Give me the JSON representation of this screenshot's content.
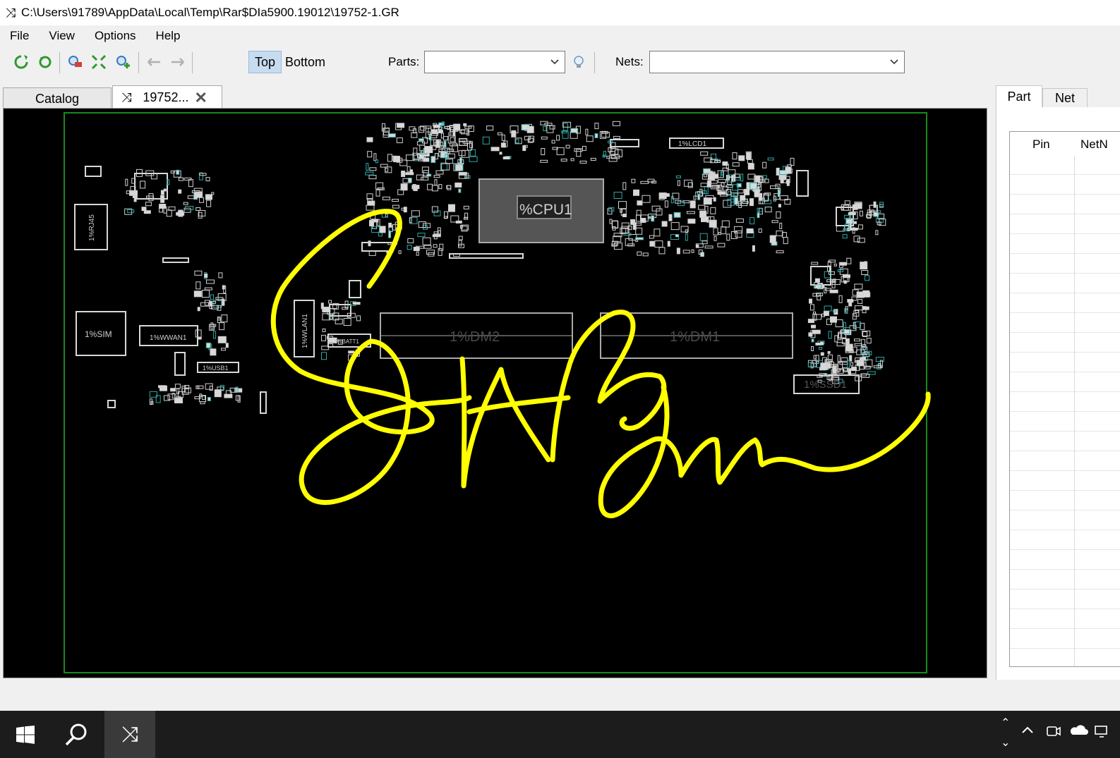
{
  "window": {
    "title": "C:\\Users\\91789\\AppData\\Local\\Temp\\Rar$DIa5900.19012\\19752-1.GR",
    "icon": "shuffle-icon"
  },
  "menu": [
    "File",
    "View",
    "Options",
    "Help"
  ],
  "toolbar": {
    "icons": [
      "refresh-icon",
      "reload-icon",
      "zoom-part-icon",
      "fit-board-icon",
      "zoom-net-icon",
      "back-arrow-icon",
      "forward-arrow-icon"
    ],
    "top_label": "Top",
    "bottom_label": "Bottom",
    "parts_label": "Parts:",
    "parts_value": "",
    "nets_label": "Nets:",
    "nets_value": "",
    "hint_icon": "lightbulb-icon"
  },
  "tabs": {
    "catalog": "Catalog",
    "file": "19752..."
  },
  "board": {
    "background": "#000000",
    "outline_color": "#1a8a1a",
    "component_color": "#d8d8d8",
    "annotation_color": "#ffff00",
    "labels": {
      "cpu": "%CPU1",
      "dm2": "1%DM2",
      "dm1": "1%DM1",
      "ssd": "1%SSD1",
      "sim": "1%SIM",
      "wwan": "1%WWAN1",
      "rj45": "1%RJ45",
      "wlan": "1%WLAN1",
      "batt": "1%BATT1",
      "usb": "1%USB1",
      "lcd": "1%LCD1"
    }
  },
  "side_panel": {
    "tabs": [
      "Part",
      "Net"
    ],
    "columns": [
      "Pin",
      "NetN"
    ]
  },
  "taskbar": {
    "icons": [
      "windows-start-icon",
      "search-icon",
      "boardviewer-app-icon"
    ],
    "tray": [
      "chevron-up-icon",
      "meet-now-icon",
      "onedrive-icon",
      "network-icon"
    ]
  }
}
